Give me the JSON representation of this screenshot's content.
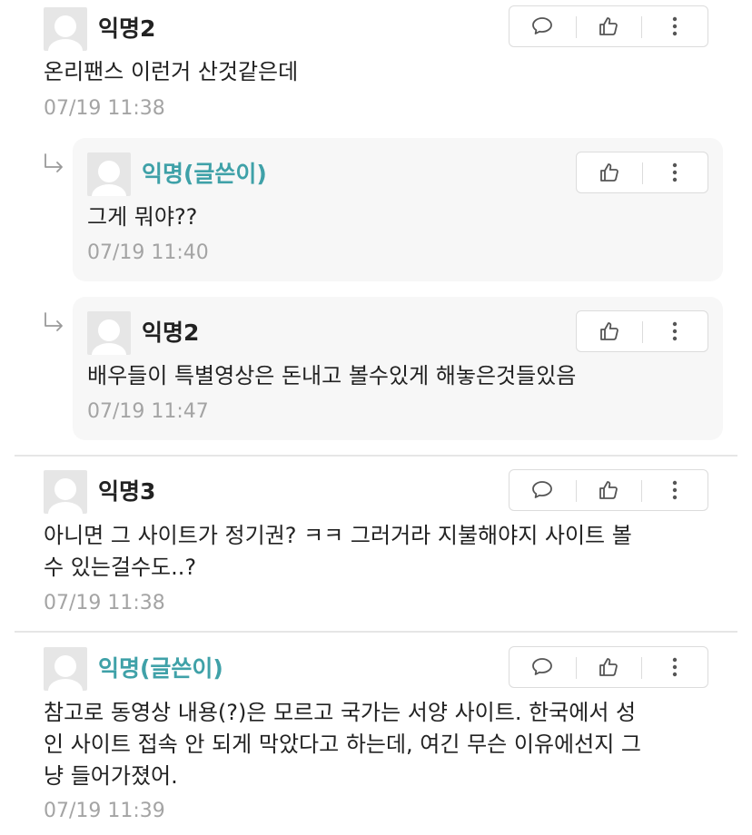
{
  "comments": [
    {
      "author": "익명2",
      "is_op": false,
      "text": "온리팬스 이런거 산것같은데",
      "time": "07/19 11:38",
      "replies": [
        {
          "author": "익명(글쓴이)",
          "is_op": true,
          "text": "그게 뭐야??",
          "time": "07/19 11:40"
        },
        {
          "author": "익명2",
          "is_op": false,
          "text": "배우들이 특별영상은 돈내고 볼수있게 해놓은것들있음",
          "time": "07/19 11:47"
        }
      ]
    },
    {
      "author": "익명3",
      "is_op": false,
      "text": "아니면 그 사이트가 정기권? ㅋㅋ 그러거라 지불해야지 사이트 볼\n수 있는걸수도..?",
      "time": "07/19 11:38"
    },
    {
      "author": "익명(글쓴이)",
      "is_op": true,
      "text": "참고로 동영상 내용(?)은 모르고 국가는 서양 사이트. 한국에서 성\n인 사이트 접속 안 되게 막았다고 하는데, 여긴 무슨 이유에선지 그\n냥 들어가졌어.",
      "time": "07/19 11:39"
    }
  ],
  "icons": {
    "reply": "speech-bubble-icon",
    "like": "thumbs-up-icon",
    "more": "vertical-dots-icon"
  },
  "colors": {
    "op_name": "#3fa1a8",
    "timestamp": "#a4a4a4",
    "reply_background": "#f7f7f7"
  }
}
